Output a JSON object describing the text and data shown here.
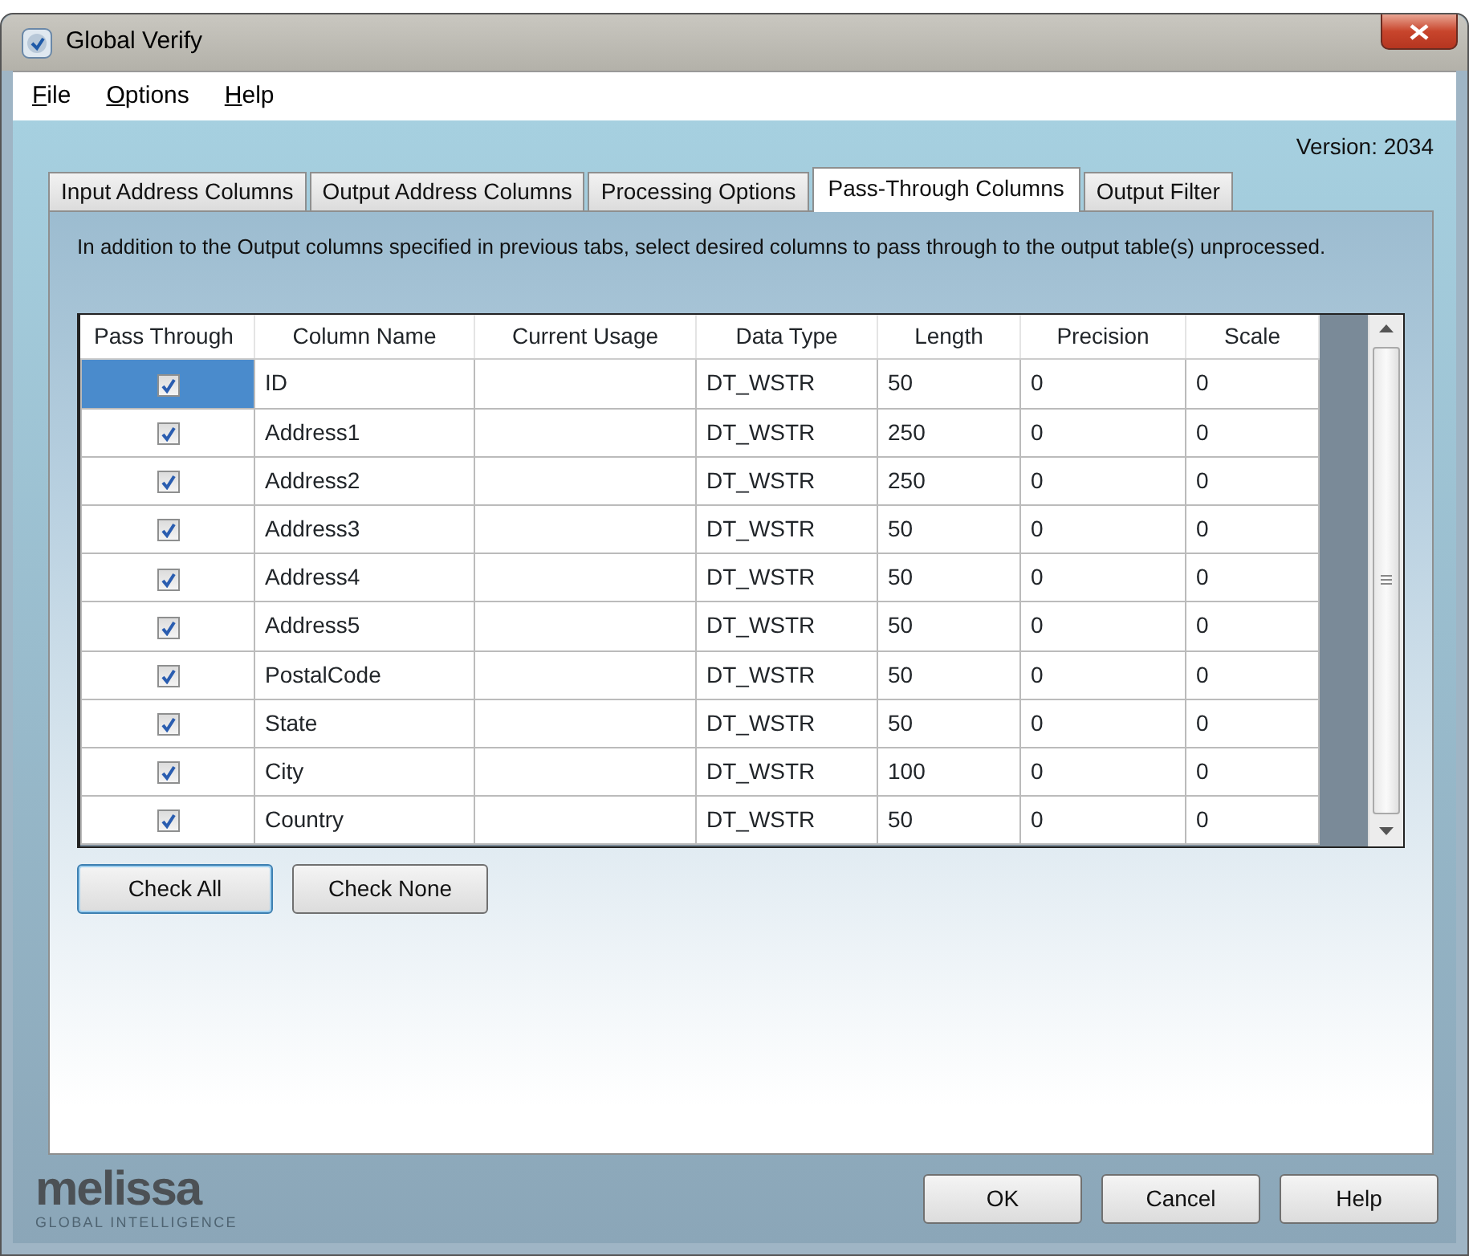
{
  "window": {
    "title": "Global Verify"
  },
  "menu": [
    {
      "label": "File"
    },
    {
      "label": "Options"
    },
    {
      "label": "Help"
    }
  ],
  "version": "Version: 2034",
  "tabs": [
    {
      "label": "Input Address Columns",
      "selected": false
    },
    {
      "label": "Output Address Columns",
      "selected": false
    },
    {
      "label": "Processing Options",
      "selected": false
    },
    {
      "label": "Pass-Through Columns",
      "selected": true
    },
    {
      "label": "Output Filter",
      "selected": false
    }
  ],
  "description": "In addition to the Output columns specified in previous tabs, select desired columns to pass through to the output table(s) unprocessed.",
  "table": {
    "columns": [
      "Pass Through",
      "Column Name",
      "Current Usage",
      "Data Type",
      "Length",
      "Precision",
      "Scale"
    ],
    "rows": [
      {
        "checked": true,
        "selected": true,
        "cells": [
          "",
          "ID",
          "",
          "DT_WSTR",
          "50",
          "0",
          "0"
        ]
      },
      {
        "checked": true,
        "selected": false,
        "cells": [
          "",
          "Address1",
          "",
          "DT_WSTR",
          "250",
          "0",
          "0"
        ]
      },
      {
        "checked": true,
        "selected": false,
        "cells": [
          "",
          "Address2",
          "",
          "DT_WSTR",
          "250",
          "0",
          "0"
        ]
      },
      {
        "checked": true,
        "selected": false,
        "cells": [
          "",
          "Address3",
          "",
          "DT_WSTR",
          "50",
          "0",
          "0"
        ]
      },
      {
        "checked": true,
        "selected": false,
        "cells": [
          "",
          "Address4",
          "",
          "DT_WSTR",
          "50",
          "0",
          "0"
        ]
      },
      {
        "checked": true,
        "selected": false,
        "cells": [
          "",
          "Address5",
          "",
          "DT_WSTR",
          "50",
          "0",
          "0"
        ]
      },
      {
        "checked": true,
        "selected": false,
        "cells": [
          "",
          "PostalCode",
          "",
          "DT_WSTR",
          "50",
          "0",
          "0"
        ]
      },
      {
        "checked": true,
        "selected": false,
        "cells": [
          "",
          "State",
          "",
          "DT_WSTR",
          "50",
          "0",
          "0"
        ]
      },
      {
        "checked": true,
        "selected": false,
        "cells": [
          "",
          "City",
          "",
          "DT_WSTR",
          "100",
          "0",
          "0"
        ]
      },
      {
        "checked": true,
        "selected": false,
        "cells": [
          "",
          "Country",
          "",
          "DT_WSTR",
          "50",
          "0",
          "0"
        ]
      }
    ]
  },
  "panel_buttons": [
    {
      "label": "Check All",
      "focused": true
    },
    {
      "label": "Check None",
      "focused": false
    }
  ],
  "logo": {
    "name": "melissa",
    "tagline": "GLOBAL INTELLIGENCE"
  },
  "buttons": [
    "OK",
    "Cancel",
    "Help"
  ]
}
